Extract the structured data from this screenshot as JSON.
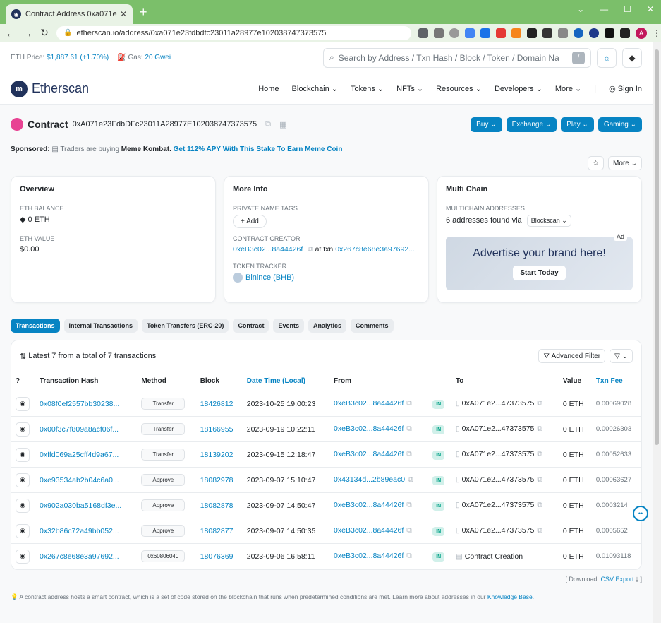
{
  "browser": {
    "tab_title": "Contract Address 0xa071e23fc",
    "url": "etherscan.io/address/0xa071e23fdbdfc23011a28977e102038747373575",
    "win_min": "—",
    "win_max": "☐",
    "win_close": "✕",
    "avatar_letter": "A"
  },
  "topstrip": {
    "eth_price_label": "ETH Price:",
    "eth_price_value": "$1,887.61 (+1.70%)",
    "gas_label": "Gas:",
    "gas_value": "20 Gwei",
    "search_placeholder": "Search by Address / Txn Hash / Block / Token / Domain Na",
    "slash": "/"
  },
  "header": {
    "logo_text": "Etherscan",
    "nav": [
      "Home",
      "Blockchain ⌄",
      "Tokens ⌄",
      "NFTs ⌄",
      "Resources ⌄",
      "Developers ⌄",
      "More ⌄"
    ],
    "sign_in": "Sign In"
  },
  "contract": {
    "label": "Contract",
    "address": "0xA071e23FdbDFc23011A28977E102038747373575",
    "buttons": [
      "Buy ⌄",
      "Exchange ⌄",
      "Play ⌄",
      "Gaming ⌄"
    ]
  },
  "sponsored": {
    "label": "Sponsored:",
    "text": "Traders are buying",
    "bold": "Meme Kombat.",
    "link": "Get 112% APY With This Stake To Earn Meme Coin"
  },
  "more_button": "More ⌄",
  "overview": {
    "title": "Overview",
    "eth_balance_label": "ETH BALANCE",
    "eth_balance_value": "0 ETH",
    "eth_value_label": "ETH VALUE",
    "eth_value_value": "$0.00"
  },
  "more_info": {
    "title": "More Info",
    "private_tags_label": "PRIVATE NAME TAGS",
    "add_button": "+ Add",
    "creator_label": "CONTRACT CREATOR",
    "creator_address": "0xeB3c02...8a44426f",
    "at_txn": "at txn",
    "creator_txn": "0x267c8e68e3a97692...",
    "token_tracker_label": "TOKEN TRACKER",
    "token_name": "Binince (BHB)"
  },
  "multichain": {
    "title": "Multi Chain",
    "label": "MULTICHAIN ADDRESSES",
    "text": "6 addresses found via",
    "select": "Blockscan ⌄",
    "ad_title": "Advertise your brand here!",
    "ad_button": "Start Today",
    "ad_tag": "Ad"
  },
  "tabs": [
    "Transactions",
    "Internal Transactions",
    "Token Transfers (ERC-20)",
    "Contract",
    "Events",
    "Analytics",
    "Comments"
  ],
  "transactions": {
    "summary": "Latest 7 from a total of 7 transactions",
    "advanced_filter": "Advanced Filter",
    "columns": [
      "Transaction Hash",
      "Method",
      "Block",
      "Date Time (Local)",
      "From",
      "",
      "To",
      "Value",
      "Txn Fee"
    ],
    "rows": [
      {
        "hash": "0x08f0ef2557bb30238...",
        "method": "Transfer",
        "block": "18426812",
        "time": "2023-10-25 19:00:23",
        "from": "0xeB3c02...8a44426f",
        "dir": "IN",
        "to": "0xA071e2...47373575",
        "value": "0 ETH",
        "fee": "0.00069028"
      },
      {
        "hash": "0x00f3c7f809a8acf06f...",
        "method": "Transfer",
        "block": "18166955",
        "time": "2023-09-19 10:22:11",
        "from": "0xeB3c02...8a44426f",
        "dir": "IN",
        "to": "0xA071e2...47373575",
        "value": "0 ETH",
        "fee": "0.00026303"
      },
      {
        "hash": "0xffd069a25cff4d9a67...",
        "method": "Transfer",
        "block": "18139202",
        "time": "2023-09-15 12:18:47",
        "from": "0xeB3c02...8a44426f",
        "dir": "IN",
        "to": "0xA071e2...47373575",
        "value": "0 ETH",
        "fee": "0.00052633"
      },
      {
        "hash": "0xe93534ab2b04c6a0...",
        "method": "Approve",
        "block": "18082978",
        "time": "2023-09-07 15:10:47",
        "from": "0x43134d...2b89eac0",
        "dir": "IN",
        "to": "0xA071e2...47373575",
        "value": "0 ETH",
        "fee": "0.00063627"
      },
      {
        "hash": "0x902a030ba5168df3e...",
        "method": "Approve",
        "block": "18082878",
        "time": "2023-09-07 14:50:47",
        "from": "0xeB3c02...8a44426f",
        "dir": "IN",
        "to": "0xA071e2...47373575",
        "value": "0 ETH",
        "fee": "0.0003214"
      },
      {
        "hash": "0x32b86c72a49bb052...",
        "method": "Approve",
        "block": "18082877",
        "time": "2023-09-07 14:50:35",
        "from": "0xeB3c02...8a44426f",
        "dir": "IN",
        "to": "0xA071e2...47373575",
        "value": "0 ETH",
        "fee": "0.0005652"
      },
      {
        "hash": "0x267c8e68e3a97692...",
        "method": "0x60806040",
        "block": "18076369",
        "time": "2023-09-06 16:58:11",
        "from": "0xeB3c02...8a44426f",
        "dir": "IN",
        "to": "Contract Creation",
        "value": "0 ETH",
        "fee": "0.01093118"
      }
    ]
  },
  "download": {
    "prefix": "[ Download:",
    "link": "CSV Export",
    "suffix": "]"
  },
  "footnote": {
    "text": "A contract address hosts a smart contract, which is a set of code stored on the blockchain that runs when predetermined conditions are met. Learn more about addresses in our",
    "link": "Knowledge Base."
  },
  "colors": {
    "accent": "#0784c3",
    "brand": "#21325b",
    "tabbar": "#7bbf6a",
    "in_badge": "#00a186"
  }
}
